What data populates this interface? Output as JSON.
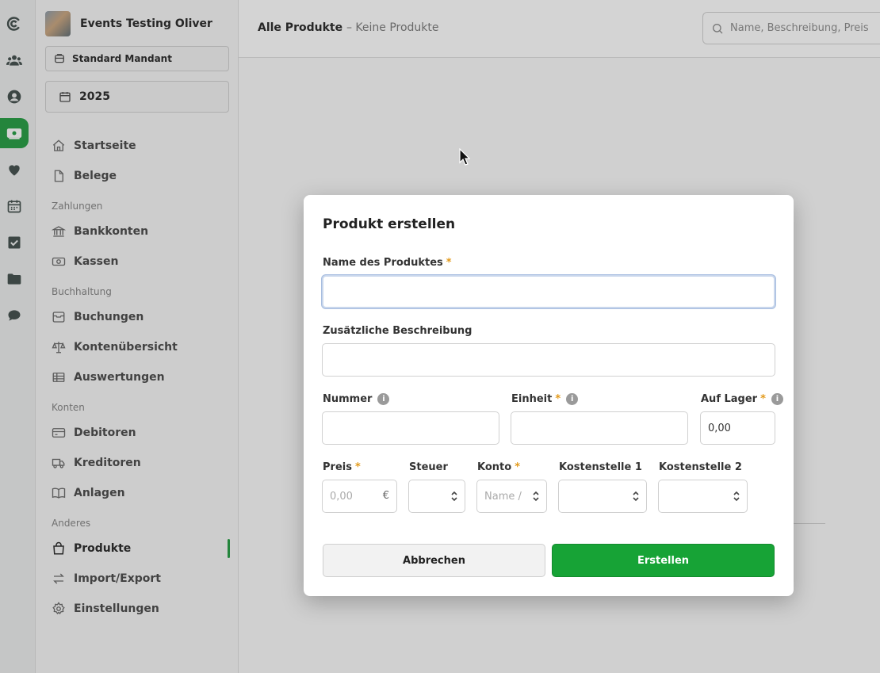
{
  "org": {
    "name": "Events Testing Oliver"
  },
  "mandant": {
    "label": "Standard Mandant"
  },
  "year": {
    "label": "2025"
  },
  "nav": {
    "items_top": [
      {
        "label": "Startseite",
        "icon": "home-icon"
      },
      {
        "label": "Belege",
        "icon": "document-icon"
      }
    ],
    "sections": [
      {
        "title": "Zahlungen",
        "items": [
          {
            "label": "Bankkonten",
            "icon": "bank-icon"
          },
          {
            "label": "Kassen",
            "icon": "cash-icon"
          }
        ]
      },
      {
        "title": "Buchhaltung",
        "items": [
          {
            "label": "Buchungen",
            "icon": "archive-icon"
          },
          {
            "label": "Kontenübersicht",
            "icon": "scale-icon"
          },
          {
            "label": "Auswertungen",
            "icon": "table-icon"
          }
        ]
      },
      {
        "title": "Konten",
        "items": [
          {
            "label": "Debitoren",
            "icon": "card-icon"
          },
          {
            "label": "Kreditoren",
            "icon": "truck-icon"
          },
          {
            "label": "Anlagen",
            "icon": "book-icon"
          }
        ]
      },
      {
        "title": "Anderes",
        "items": [
          {
            "label": "Produkte",
            "icon": "bag-icon",
            "active": true
          },
          {
            "label": "Import/Export",
            "icon": "arrows-icon"
          },
          {
            "label": "Einstellungen",
            "icon": "gear-icon"
          }
        ]
      }
    ]
  },
  "header": {
    "title": "Alle Produkte",
    "subtitle": "– Keine Produkte",
    "search_placeholder": "Name, Beschreibung, Preis"
  },
  "modal": {
    "title": "Produkt erstellen",
    "name_label": "Name des Produktes",
    "name_value": "",
    "description_label": "Zusätzliche Beschreibung",
    "number_label": "Nummer",
    "unit_label": "Einheit",
    "stock_label": "Auf Lager",
    "stock_value": "0,00",
    "price_label": "Preis",
    "price_placeholder": "0,00",
    "currency": "€",
    "tax_label": "Steuer",
    "account_label": "Konto",
    "account_placeholder": "Name /",
    "cost1_label": "Kostenstelle 1",
    "cost2_label": "Kostenstelle 2",
    "required_mark": "*",
    "info_mark": "i",
    "cancel_label": "Abbrechen",
    "create_label": "Erstellen"
  },
  "colors": {
    "accent": "#1e9a3d",
    "create_button": "#17a336",
    "required": "#e39a1a"
  }
}
